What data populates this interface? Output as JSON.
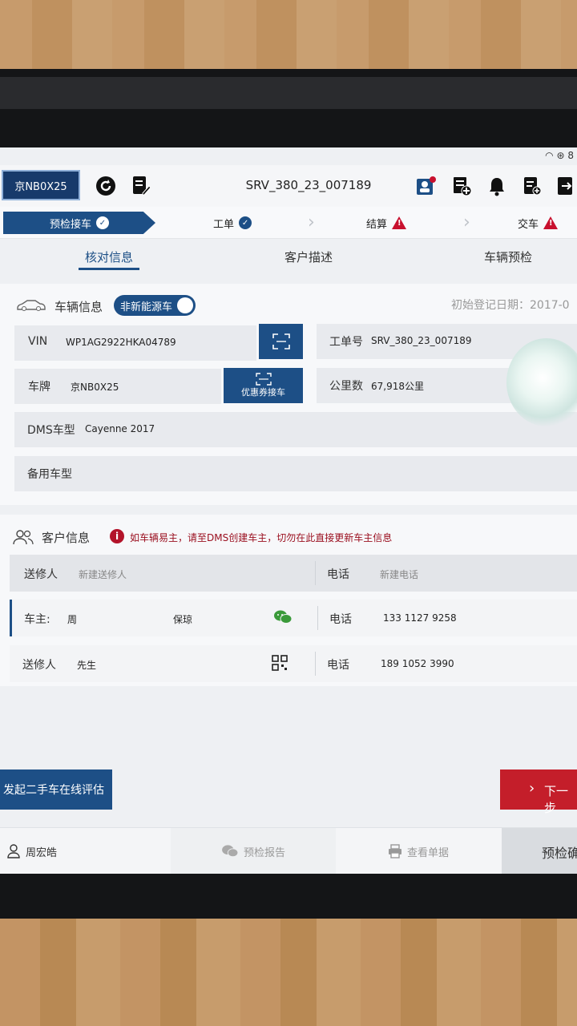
{
  "status": {
    "battery": "8"
  },
  "toolbar": {
    "plate": "京NB0X25",
    "order_no": "SRV_380_23_007189"
  },
  "steps": [
    {
      "label": "预检接车",
      "state": "done"
    },
    {
      "label": "工单",
      "state": "done"
    },
    {
      "label": "结算",
      "state": "warning"
    },
    {
      "label": "交车",
      "state": "warning"
    }
  ],
  "tabs": [
    "核对信息",
    "客户描述",
    "车辆预检"
  ],
  "vehicle": {
    "title": "车辆信息",
    "toggle": "非新能源车",
    "reg_date": "初始登记日期：2017-0",
    "vin_label": "VIN",
    "vin": "WP1AG2922HKA04789",
    "order_label": "工单号",
    "order_no": "SRV_380_23_007189",
    "plate_label": "车牌",
    "plate": "京NB0X25",
    "coupon_btn": "优惠券接车",
    "mileage_label": "公里数",
    "mileage": "67,918公里",
    "dms_label": "DMS车型",
    "dms_model": "Cayenne 2017",
    "backup_label": "备用车型"
  },
  "customer": {
    "title": "客户信息",
    "notice": "如车辆易主，请至DMS创建车主，切勿在此直接更新车主信息",
    "rows": [
      {
        "role": "送修人",
        "name": "新建送修人",
        "extra": "",
        "phone_label": "电话",
        "phone": "新建电话"
      },
      {
        "role": "车主:",
        "name": "周",
        "extra": "保琼",
        "phone_label": "电话",
        "phone": "133 1127 9258"
      },
      {
        "role": "送修人",
        "name": "先生",
        "extra": "",
        "phone_label": "电话",
        "phone": "189 1052 3990"
      }
    ]
  },
  "actions": {
    "evaluate": "发起二手车在线评估",
    "next": "下一步"
  },
  "bottom": {
    "user": "周宏皓",
    "report": "预检报告",
    "print": "查看单据",
    "current": "预检确"
  }
}
